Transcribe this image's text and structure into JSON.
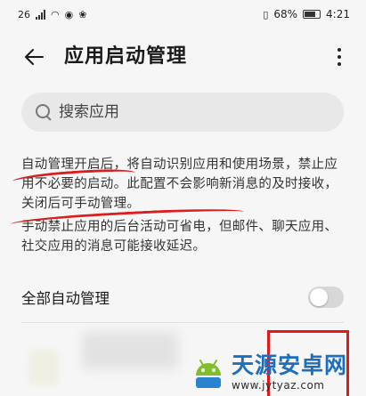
{
  "status_bar": {
    "left_glyphs": [
      "26",
      "◉",
      "❀"
    ],
    "battery_text": "68%",
    "time": "4:21"
  },
  "app_bar": {
    "back_icon": "arrow-left",
    "title": "应用启动管理",
    "more_icon": "more-vertical"
  },
  "search": {
    "placeholder": "搜索应用"
  },
  "description": {
    "paragraph1": "自动管理开启后，将自动识别应用和使用场景，禁止应用不必要的启动。此配置不会影响新消息的及时接收，关闭后可手动管理。",
    "paragraph2": "手动禁止应用的后台活动可省电，但邮件、聊天应用、社交应用的消息可能接收延迟。"
  },
  "auto_manage": {
    "label": "全部自动管理",
    "enabled": false
  },
  "watermark": {
    "title": "天源安卓网",
    "url": "www.jytyaz.com"
  },
  "colors": {
    "annotation_red": "#d81e1e",
    "watermark_blue": "#1d6fbd",
    "background": "#f6f6f6"
  }
}
